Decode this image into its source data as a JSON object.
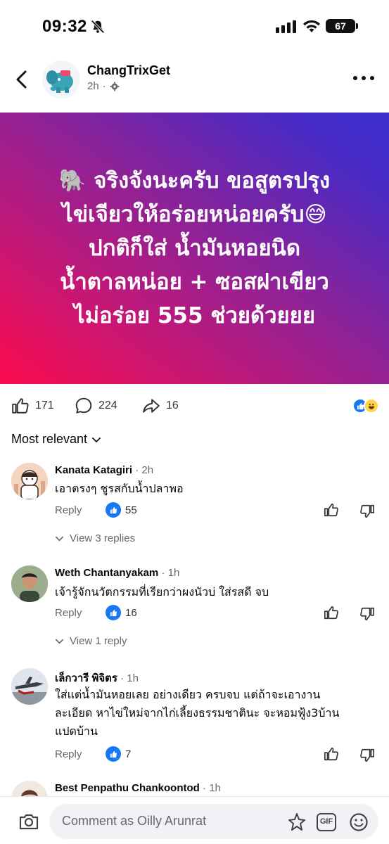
{
  "status": {
    "time": "09:32",
    "battery": "67"
  },
  "header": {
    "page_name": "ChangTrixGet",
    "time": "2h",
    "dot": "·"
  },
  "post": {
    "lines": [
      "🐘 จริงจังนะครับ ขอสูตรปรุง",
      "ไข่เจียวให้อร่อยหน่อยครับ😅",
      "ปกติก็ใส่ น้ำมันหอยนิด",
      "น้ำตาลหน่อย + ซอสฝาเขียว",
      "ไม่อร่อย 555 ช่วยด้วยยย"
    ],
    "likes": "171",
    "comments": "224",
    "shares": "16"
  },
  "sort_label": "Most relevant",
  "comments": [
    {
      "name": "Kanata Katagiri",
      "time": "2h",
      "text": "เอาตรงๆ ชูรสกับน้ำปลาพอ",
      "reply": "Reply",
      "likes": "55",
      "view": "View 3 replies"
    },
    {
      "name": "Weth Chantanyakam",
      "time": "1h",
      "text": "เจ้ารู้จักนวัตกรรมที่เรียกว่าผงนัวบ่  ใส่รสดี จบ",
      "reply": "Reply",
      "likes": "16",
      "view": "View 1 reply"
    },
    {
      "name": "เล็กวารี พิจิตร",
      "time": "1h",
      "text_lines": [
        "ใส่แต่น้ำมันหอยเลย อย่างเดียว ครบจบ   แต่ถ้าจะเอางาน",
        "ละเอียด หาไข่ใหม่จากไก่เลี้ยงธรรมชาตินะ จะหอมฟู้ง3บ้าน",
        "แปดบ้าน"
      ],
      "reply": "Reply",
      "likes": "7"
    },
    {
      "name": "Best Penpathu Chankoontod",
      "time": "1h"
    }
  ],
  "composer": {
    "placeholder": "Comment as Oilly Arunrat",
    "gif": "GIF"
  },
  "colors": {
    "accent": "#1877f2",
    "gradient_start": "#fb0a4c",
    "gradient_end": "#3b2fcf"
  }
}
